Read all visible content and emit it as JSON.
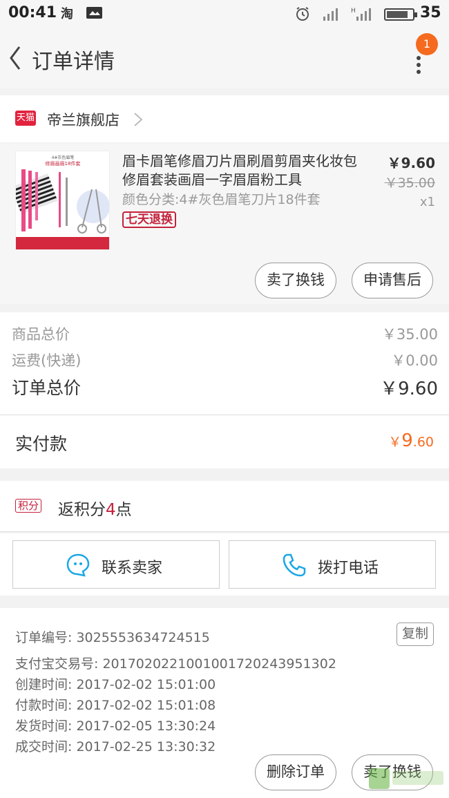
{
  "status_bar": {
    "time": "00:41",
    "battery": "35"
  },
  "header": {
    "title": "订单详情",
    "badge": "1"
  },
  "shop": {
    "platform": "天猫",
    "name": "帝兰旗舰店"
  },
  "product": {
    "thumb_caption_top": "4#灰色眉笔",
    "thumb_caption_main": "修眉画眉18件套",
    "title": "眉卡眉笔修眉刀片眉刷眉剪眉夹化妆包修眉套装画眉一字眉眉粉工具",
    "spec": "颜色分类:4#灰色眉笔刀片18件套",
    "tag": "七天退换",
    "price": "￥9.60",
    "original_price": "￥35.00",
    "quantity": "x1",
    "actions": {
      "sell": "卖了换钱",
      "after_sale": "申请售后"
    }
  },
  "totals": {
    "goods_label": "商品总价",
    "goods_value": "￥35.00",
    "shipping_label": "运费(快递)",
    "shipping_value": "￥0.00",
    "order_label": "订单总价",
    "order_value": "￥9.60",
    "paid_label": "实付款",
    "paid_currency": "￥",
    "paid_int": "9",
    "paid_dec": ".60"
  },
  "points": {
    "badge": "积分",
    "prefix": "返积分",
    "value": "4",
    "suffix": "点"
  },
  "contact": {
    "seller": "联系卖家",
    "phone": "拨打电话"
  },
  "order_info": {
    "order_no": "订单编号: 3025553634724515",
    "copy": "复制",
    "alipay_no": "支付宝交易号: 2017020221001001720243951302",
    "created": "创建时间: 2017-02-02 15:01:00",
    "paid": "付款时间: 2017-02-02 15:01:08",
    "shipped": "发货时间: 2017-02-05 13:30:24",
    "completed": "成交时间: 2017-02-25 13:30:32"
  },
  "bottom_bar": {
    "delete": "删除订单",
    "sell": "卖了换钱"
  },
  "colors": {
    "accent": "#f56a1e",
    "tmall_red": "#e2233f",
    "tag_red": "#c4213a",
    "call_blue": "#1aa7e6"
  }
}
